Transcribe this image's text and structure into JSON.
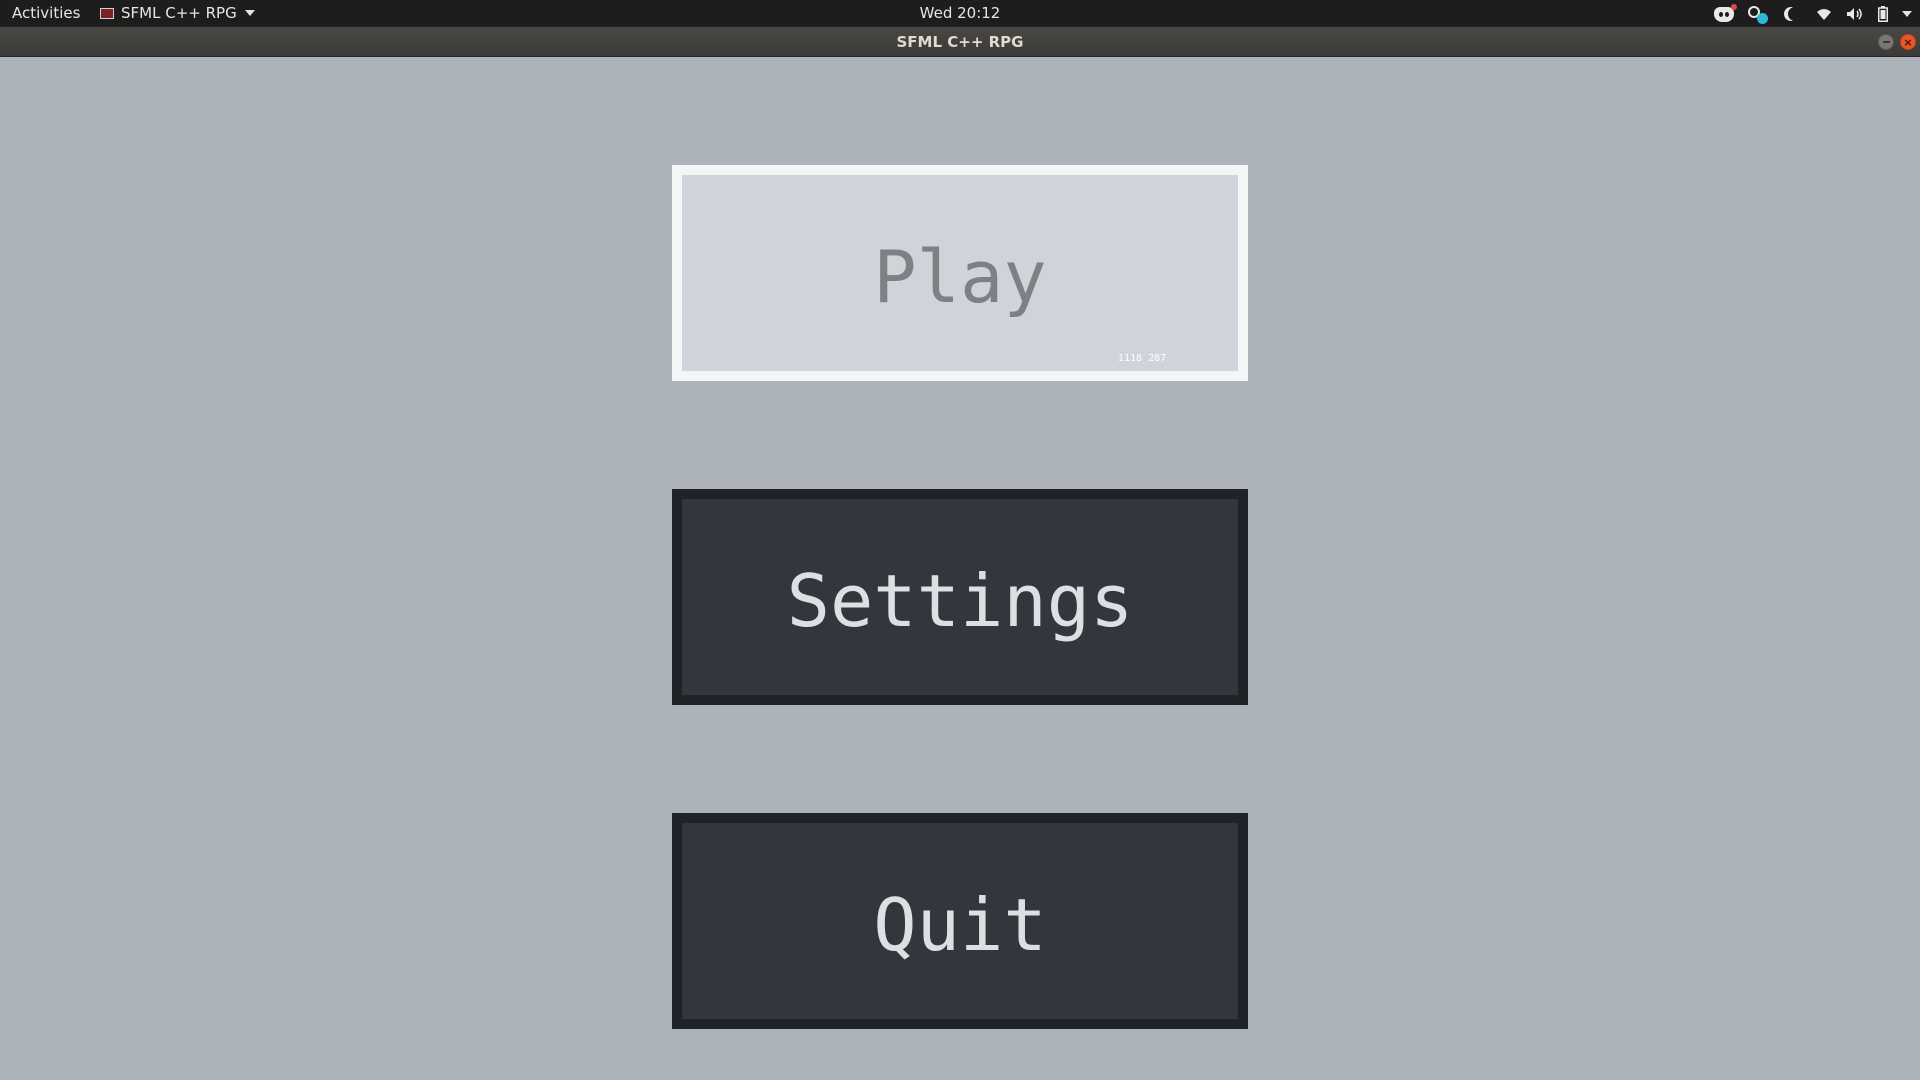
{
  "topbar": {
    "activities": "Activities",
    "app_menu_label": "SFML C++ RPG",
    "clock": "Wed 20:12",
    "tray_icons": [
      "discord-icon",
      "steam-icon",
      "night-light-icon",
      "wifi-icon",
      "volume-icon",
      "battery-icon",
      "system-menu-caret-icon"
    ]
  },
  "window": {
    "title": "SFML C++ RPG",
    "buttons": [
      "minimize",
      "close"
    ],
    "close_glyph": "×"
  },
  "game": {
    "background": "#acb3ba",
    "menu": [
      {
        "label": "Play",
        "state": "hover",
        "fill": "#cfd4da",
        "outline": "#f3f5f6",
        "text_color": "#7e8084"
      },
      {
        "label": "Settings",
        "state": "idle",
        "fill": "#32363d",
        "outline": "#1f2227",
        "text_color": "#dde0e3"
      },
      {
        "label": "Quit",
        "state": "idle",
        "fill": "#32363d",
        "outline": "#1f2227",
        "text_color": "#dde0e3"
      }
    ],
    "mouse_coords": "1118 287"
  }
}
